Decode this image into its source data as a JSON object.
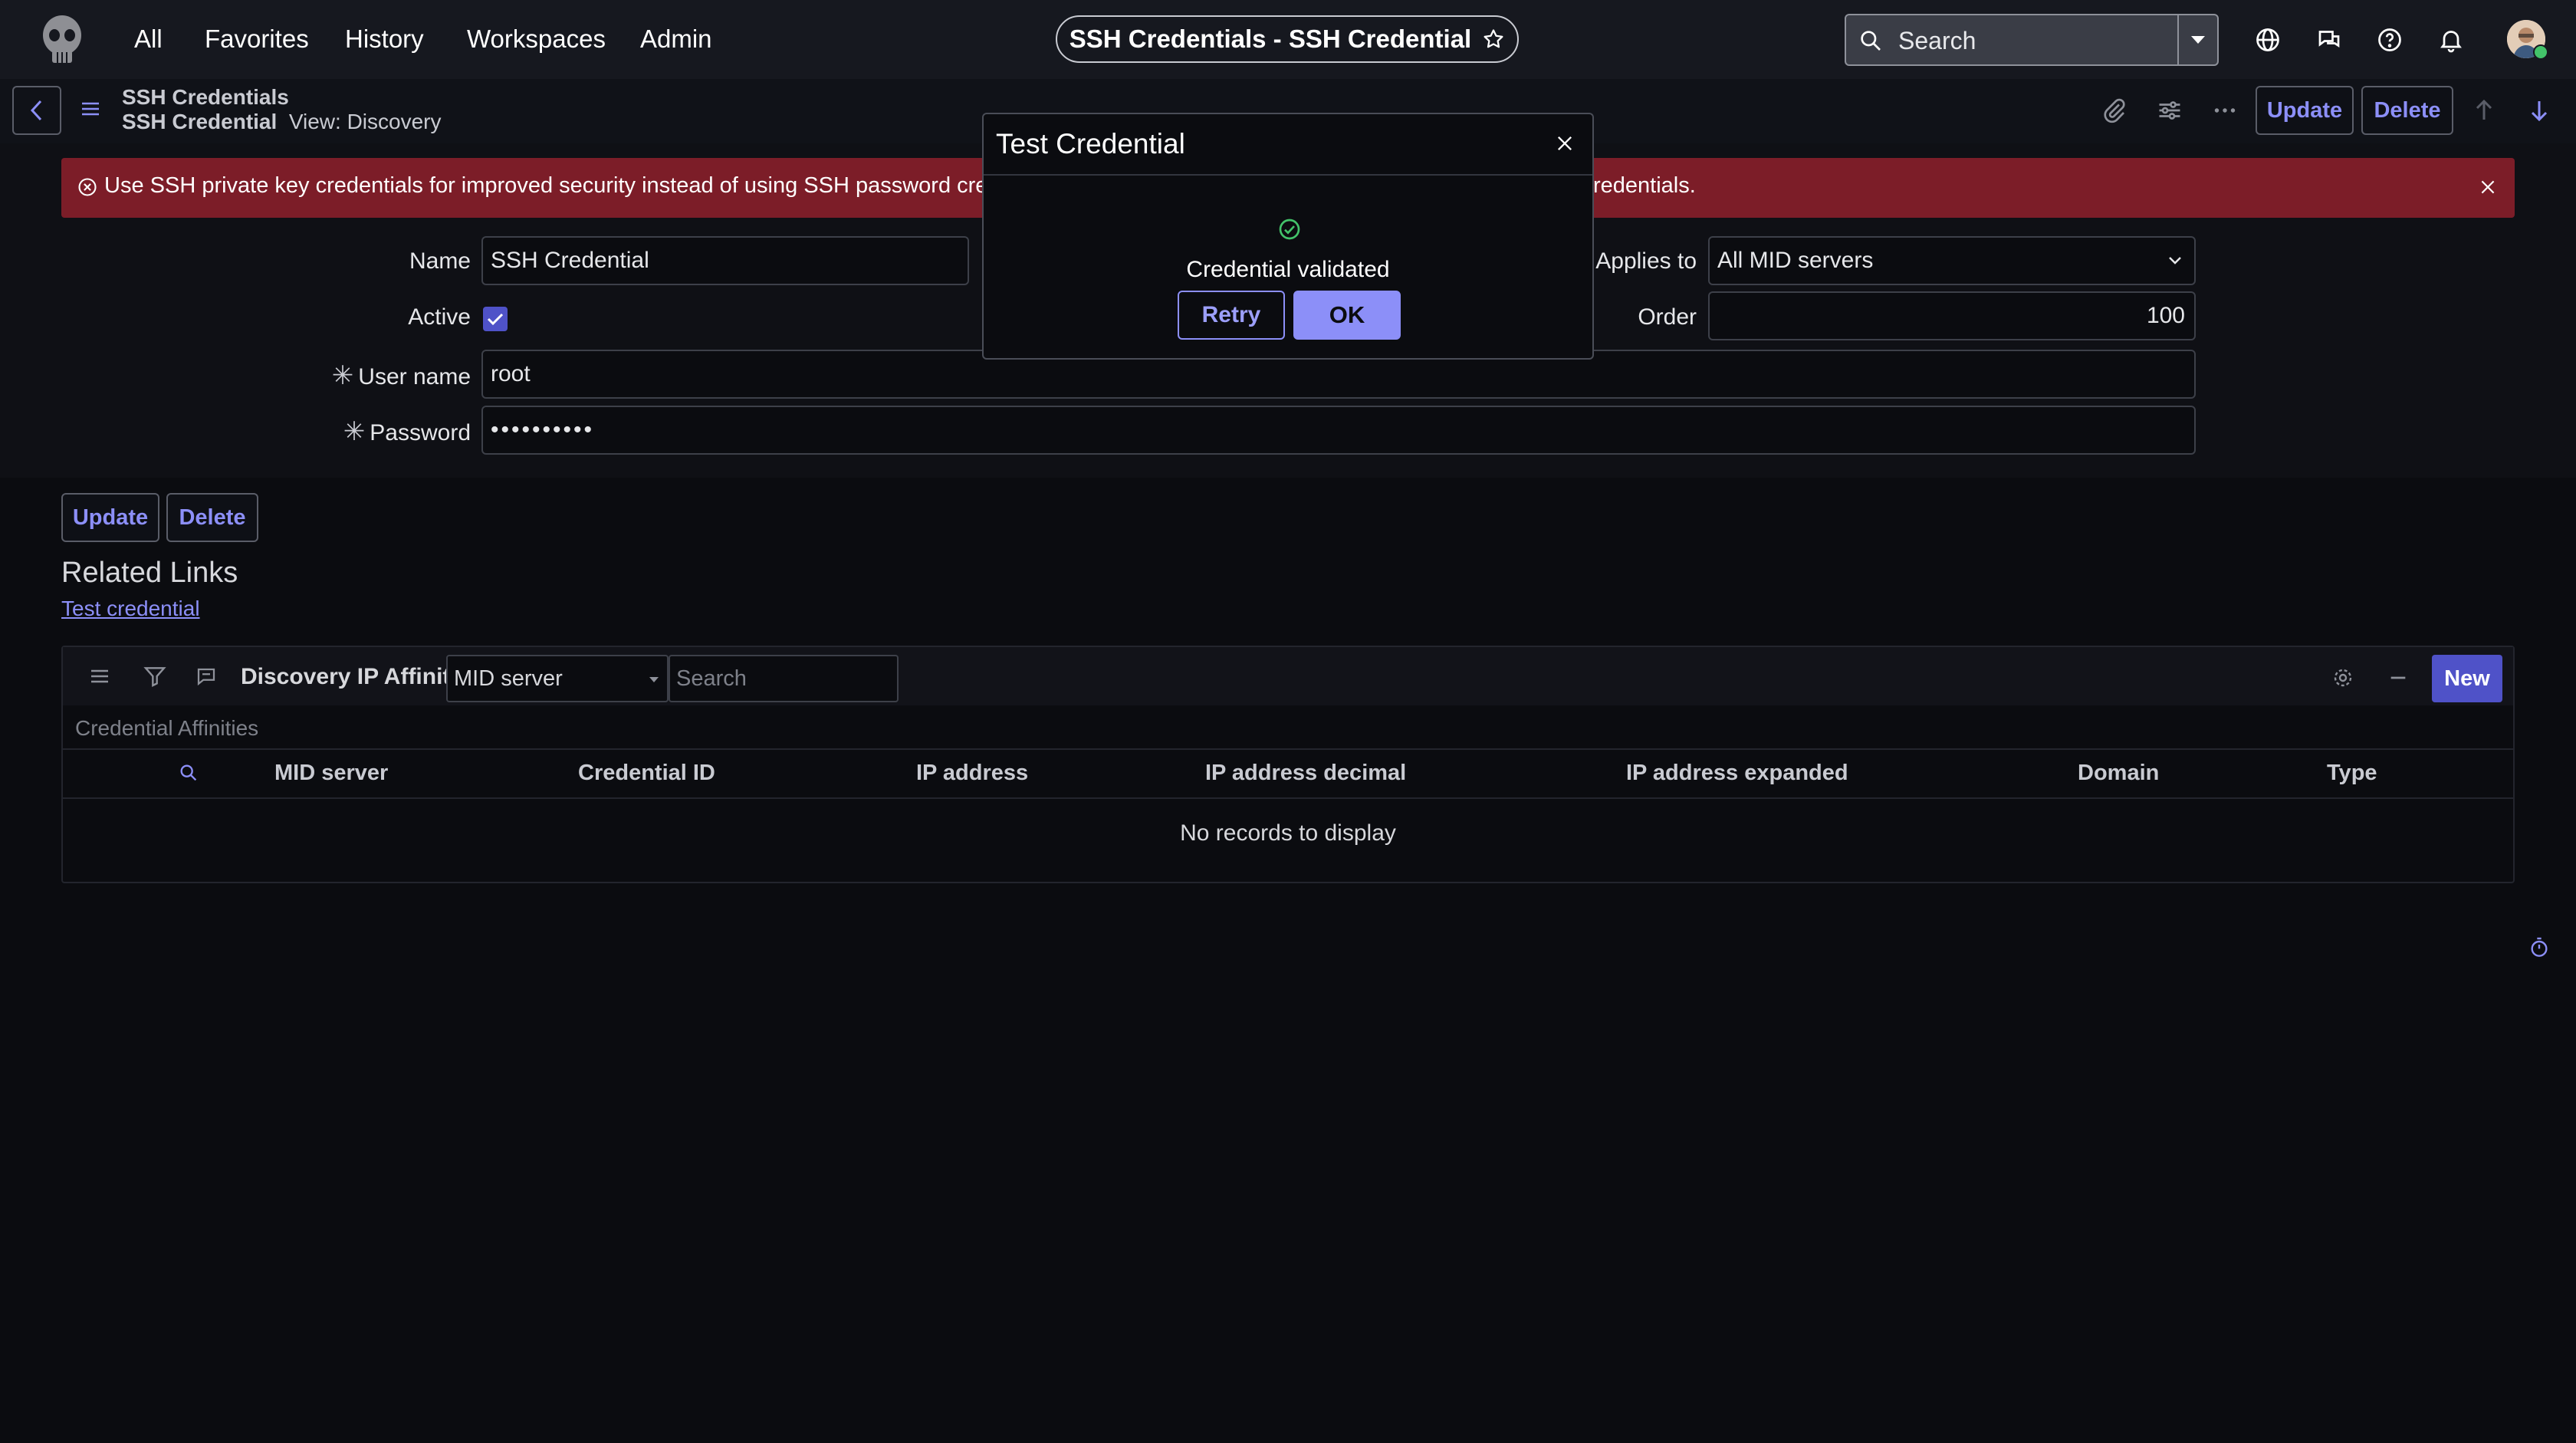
{
  "nav": {
    "items": [
      "All",
      "Favorites",
      "History",
      "Workspaces",
      "Admin"
    ],
    "context_title": "SSH Credentials - SSH Credential",
    "search_placeholder": "Search"
  },
  "record": {
    "title": "SSH Credentials",
    "subtitle_name": "SSH Credential",
    "subtitle_view": "View: Discovery",
    "update_label": "Update",
    "delete_label": "Delete"
  },
  "alert": {
    "text_left": "Use SSH private key credentials for improved security instead of using SSH password credenti",
    "text_right": "redentials."
  },
  "form": {
    "name_label": "Name",
    "name_value": "SSH Credential",
    "active_label": "Active",
    "applies_label": "Applies to",
    "applies_value": "All MID servers",
    "order_label": "Order",
    "order_value": "100",
    "username_label": "User name",
    "username_value": "root",
    "password_label": "Password",
    "password_value": "••••••••••",
    "update_label": "Update",
    "delete_label": "Delete"
  },
  "related": {
    "title": "Related Links",
    "link": "Test credential"
  },
  "related_list": {
    "title": "Discovery IP Affinity",
    "select_value": "MID server",
    "search_placeholder": "Search",
    "new_label": "New",
    "caption": "Credential Affinities",
    "columns": [
      "MID server",
      "Credential ID",
      "IP address",
      "IP address decimal",
      "IP address expanded",
      "Domain",
      "Type"
    ],
    "empty": "No records to display"
  },
  "modal": {
    "title": "Test Credential",
    "message": "Credential validated",
    "retry_label": "Retry",
    "ok_label": "OK"
  },
  "colors": {
    "accent": "#8c8ff8",
    "alert_bg": "#7c1d28",
    "success": "#43c36a"
  }
}
